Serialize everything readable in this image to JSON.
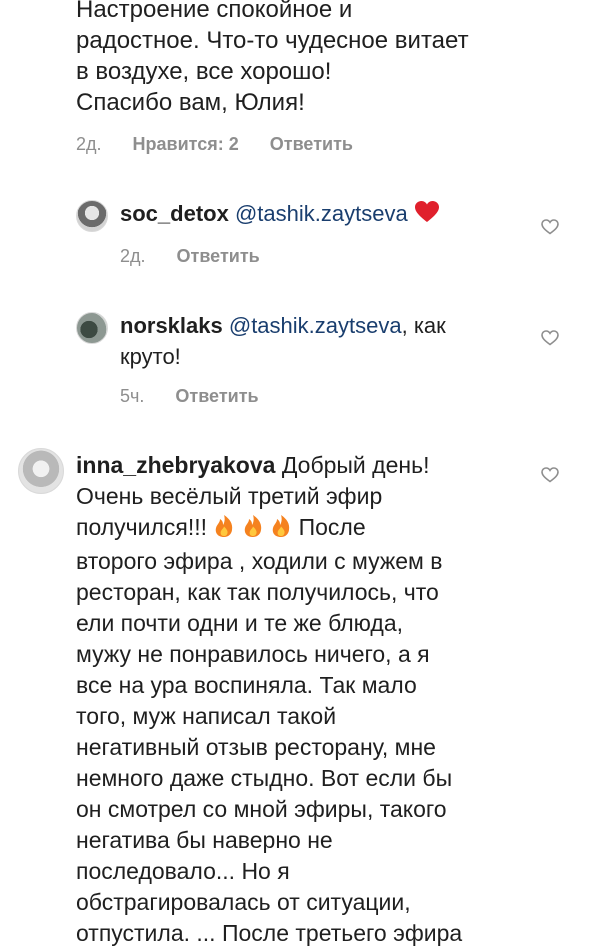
{
  "comment_top": {
    "lines": [
      "Настроение спокойное и",
      "радостное. Что-то чудесное витает",
      "в воздухе, все хорошо!",
      "Спасибо вам, Юлия!"
    ],
    "time": "2д.",
    "likes": "Нравится: 2",
    "reply": "Ответить"
  },
  "replies": [
    {
      "username": "soc_detox",
      "mention": "@tashik.zaytseva",
      "text_after": "",
      "emoji": "red-heart",
      "time": "2д.",
      "reply": "Ответить"
    },
    {
      "username": "norsklaks",
      "mention": "@tashik.zaytseva",
      "text_after": ", как",
      "text_line2": "круто!",
      "time": "5ч.",
      "reply": "Ответить"
    }
  ],
  "comment_main": {
    "username": "inna_zhebryakova",
    "first_line_text": "Добрый день!",
    "line2": "Очень весёлый третий эфир",
    "line3_start": "получился!!!",
    "line3_end": "После",
    "lines_rest": [
      "второго эфира , ходили с мужем в",
      "ресторан, как так получилось, что",
      "ели почти одни и те же блюда,",
      "мужу не понравилось ничего, а я",
      "все на ура воспиняла. Так мало",
      "того, муж написал такой",
      "негативный отзыв ресторану, мне",
      "немного даже стыдно. Вот если бы",
      "он смотрел со мной эфиры, такого",
      "негатива бы наверно не",
      "последовало... Но я",
      "обстрагировалась от ситуации,",
      "отпустила. ... После третьего эфира"
    ]
  },
  "icons": {
    "heart_outline": "heart-outline-icon",
    "fire": "fire-emoji",
    "red_heart": "red-heart-emoji"
  },
  "colors": {
    "text": "#1f1f1f",
    "meta": "#8e8e8e",
    "mention": "#1a3e6e"
  }
}
